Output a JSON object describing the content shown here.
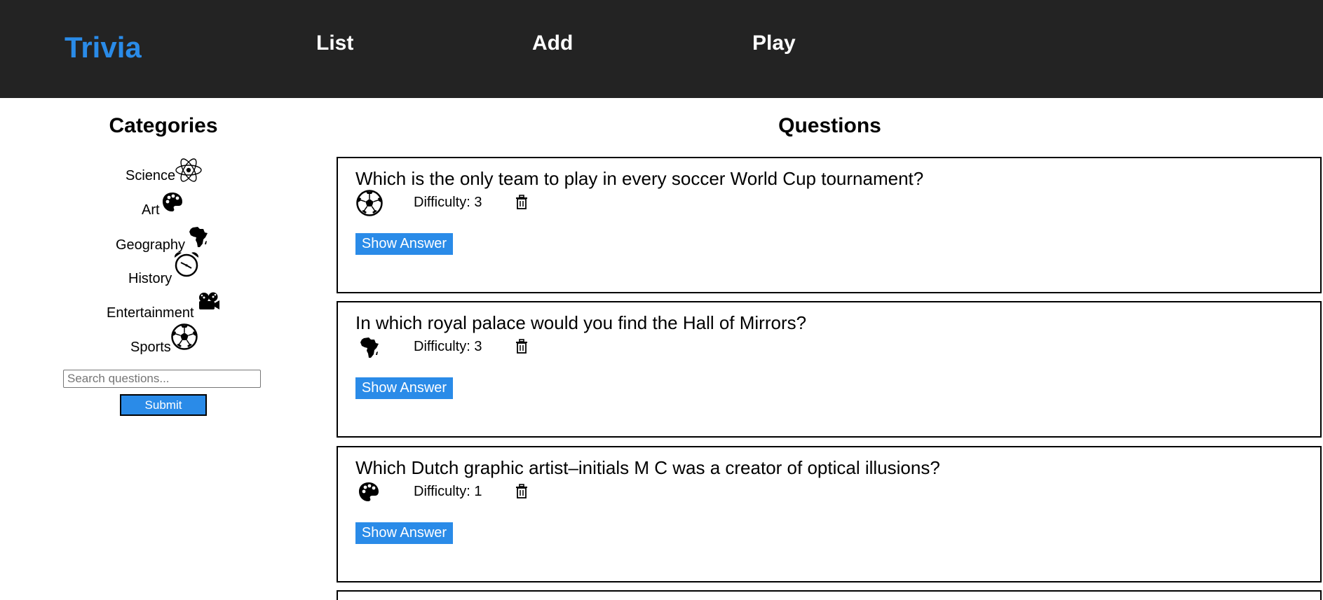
{
  "nav": {
    "brand": "Trivia",
    "links": [
      "List",
      "Add",
      "Play"
    ]
  },
  "sidebar": {
    "heading": "Categories",
    "categories": [
      {
        "label": "Science",
        "icon": "atom-icon"
      },
      {
        "label": "Art",
        "icon": "palette-icon"
      },
      {
        "label": "Geography",
        "icon": "africa-map-icon"
      },
      {
        "label": "History",
        "icon": "alarm-clock-icon"
      },
      {
        "label": "Entertainment",
        "icon": "film-projector-icon"
      },
      {
        "label": "Sports",
        "icon": "soccer-ball-icon"
      }
    ],
    "search_placeholder": "Search questions...",
    "submit_label": "Submit"
  },
  "main": {
    "heading": "Questions",
    "questions": [
      {
        "text": "Which is the only team to play in every soccer World Cup tournament?",
        "difficulty": "Difficulty: 3",
        "category_icon": "soccer-ball-icon",
        "show_answer": "Show Answer"
      },
      {
        "text": "In which royal palace would you find the Hall of Mirrors?",
        "difficulty": "Difficulty: 3",
        "category_icon": "africa-map-icon",
        "show_answer": "Show Answer"
      },
      {
        "text": "Which Dutch graphic artist–initials M C was a creator of optical illusions?",
        "difficulty": "Difficulty: 1",
        "category_icon": "palette-icon",
        "show_answer": "Show Answer"
      }
    ]
  },
  "colors": {
    "topbar": "#232323",
    "brand": "#2a8be8",
    "button": "#2a8be8"
  }
}
